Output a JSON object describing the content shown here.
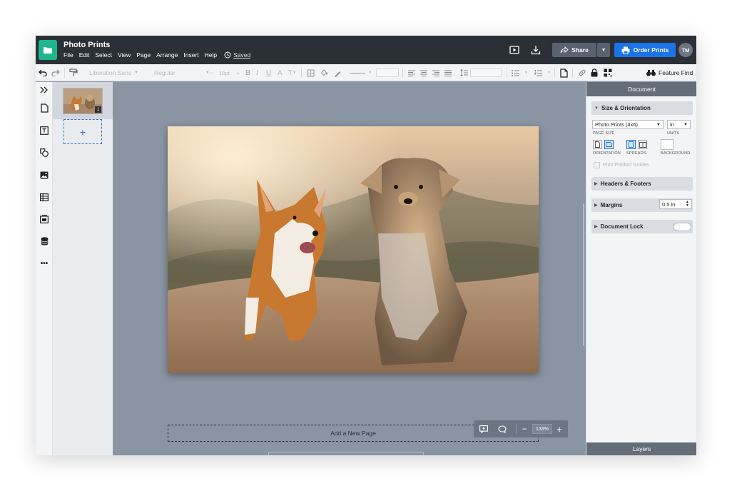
{
  "app": {
    "title": "Photo Prints",
    "menu": [
      "File",
      "Edit",
      "Select",
      "View",
      "Page",
      "Arrange",
      "Insert",
      "Help"
    ],
    "save_status": "Saved",
    "share_label": "Share",
    "order_label": "Order Prints",
    "avatar_initials": "TM",
    "accent_color": "#1a73e8",
    "brand_color": "#1fb58f"
  },
  "toolbar": {
    "font_family": "Liberation Sans",
    "font_weight": "Regular",
    "font_size": "18pt",
    "bold": "B",
    "italic": "I",
    "underline": "U",
    "text_color": "A",
    "text_options": "T",
    "feature_find": "Feature Find"
  },
  "pages": {
    "page_number": "1",
    "add_symbol": "+"
  },
  "canvas": {
    "add_new_page": "Add a New Page",
    "zoom": "133%",
    "zoom_minus": "−",
    "zoom_plus": "+"
  },
  "right_panel": {
    "header": "Document",
    "size_section": "Size & Orientation",
    "page_size_value": "Photo Prints (4x6)",
    "page_size_label": "PAGE SIZE",
    "units_value": "in",
    "units_label": "UNITS",
    "orientation_label": "ORIENTATION",
    "spreads_label": "SPREADS",
    "background_label": "BACKGROUND",
    "print_guides": "Print Product Guides",
    "headers_footers": "Headers & Footers",
    "margins": "Margins",
    "margins_value": "0.5 in",
    "document_lock": "Document Lock",
    "layers": "Layers"
  }
}
